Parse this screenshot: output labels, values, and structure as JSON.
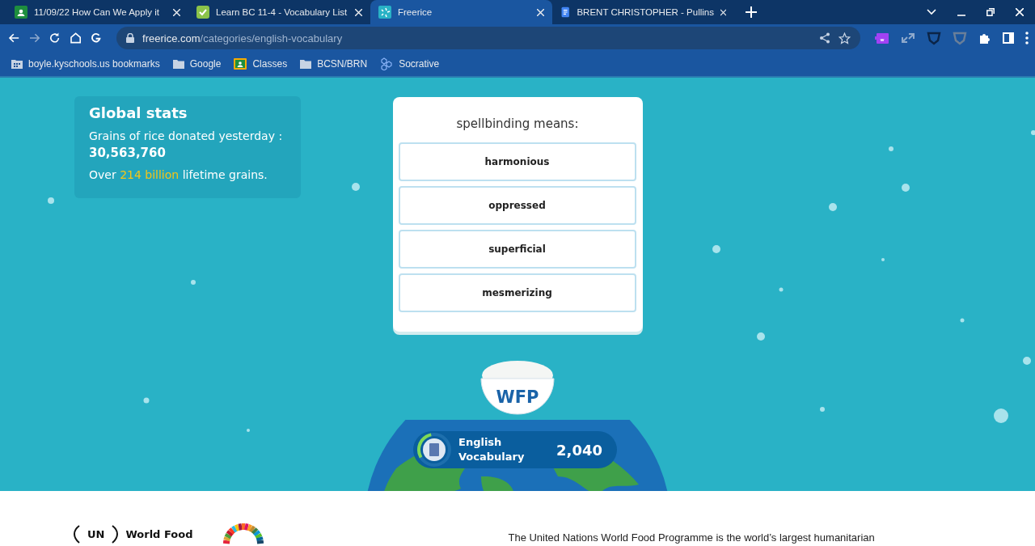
{
  "browser": {
    "tabs": [
      {
        "title": "11/09/22 How Can We Apply it",
        "kind": "classroom",
        "selected": false
      },
      {
        "title": "Learn BC 11-4 - Vocabulary List",
        "kind": "check",
        "selected": false
      },
      {
        "title": "Freerice",
        "kind": "freerice",
        "selected": true
      },
      {
        "title": "BRENT CHRISTOPHER - Pullins",
        "kind": "docs",
        "selected": false
      }
    ],
    "address": {
      "host": "freerice.com",
      "path": "/categories/english-vocabulary"
    },
    "bookmarks": [
      {
        "label": "boyle.kyschools.us bookmarks",
        "kind": "apps"
      },
      {
        "label": "Google",
        "kind": "folder"
      },
      {
        "label": "Classes",
        "kind": "classroom"
      },
      {
        "label": "BCSN/BRN",
        "kind": "folder"
      },
      {
        "label": "Socrative",
        "kind": "socrative"
      }
    ]
  },
  "stats": {
    "title": "Global stats",
    "label": "Grains of rice donated yesterday :",
    "count": "30,563,760",
    "lifetime_prefix": "Over",
    "lifetime_amount": "214 billion",
    "lifetime_suffix": "lifetime grains."
  },
  "quiz": {
    "question": "spellbinding means:",
    "answers": [
      "harmonious",
      "oppressed",
      "superficial",
      "mesmerizing"
    ]
  },
  "bowl": {
    "label": "WFP"
  },
  "category": {
    "name_line1": "English",
    "name_line2": "Vocabulary",
    "score": "2,040",
    "level": 0.3
  },
  "footer": {
    "logo_un": "UN",
    "logo_name": "World Food",
    "text": "The United Nations World Food Programme is the world’s largest humanitarian"
  }
}
